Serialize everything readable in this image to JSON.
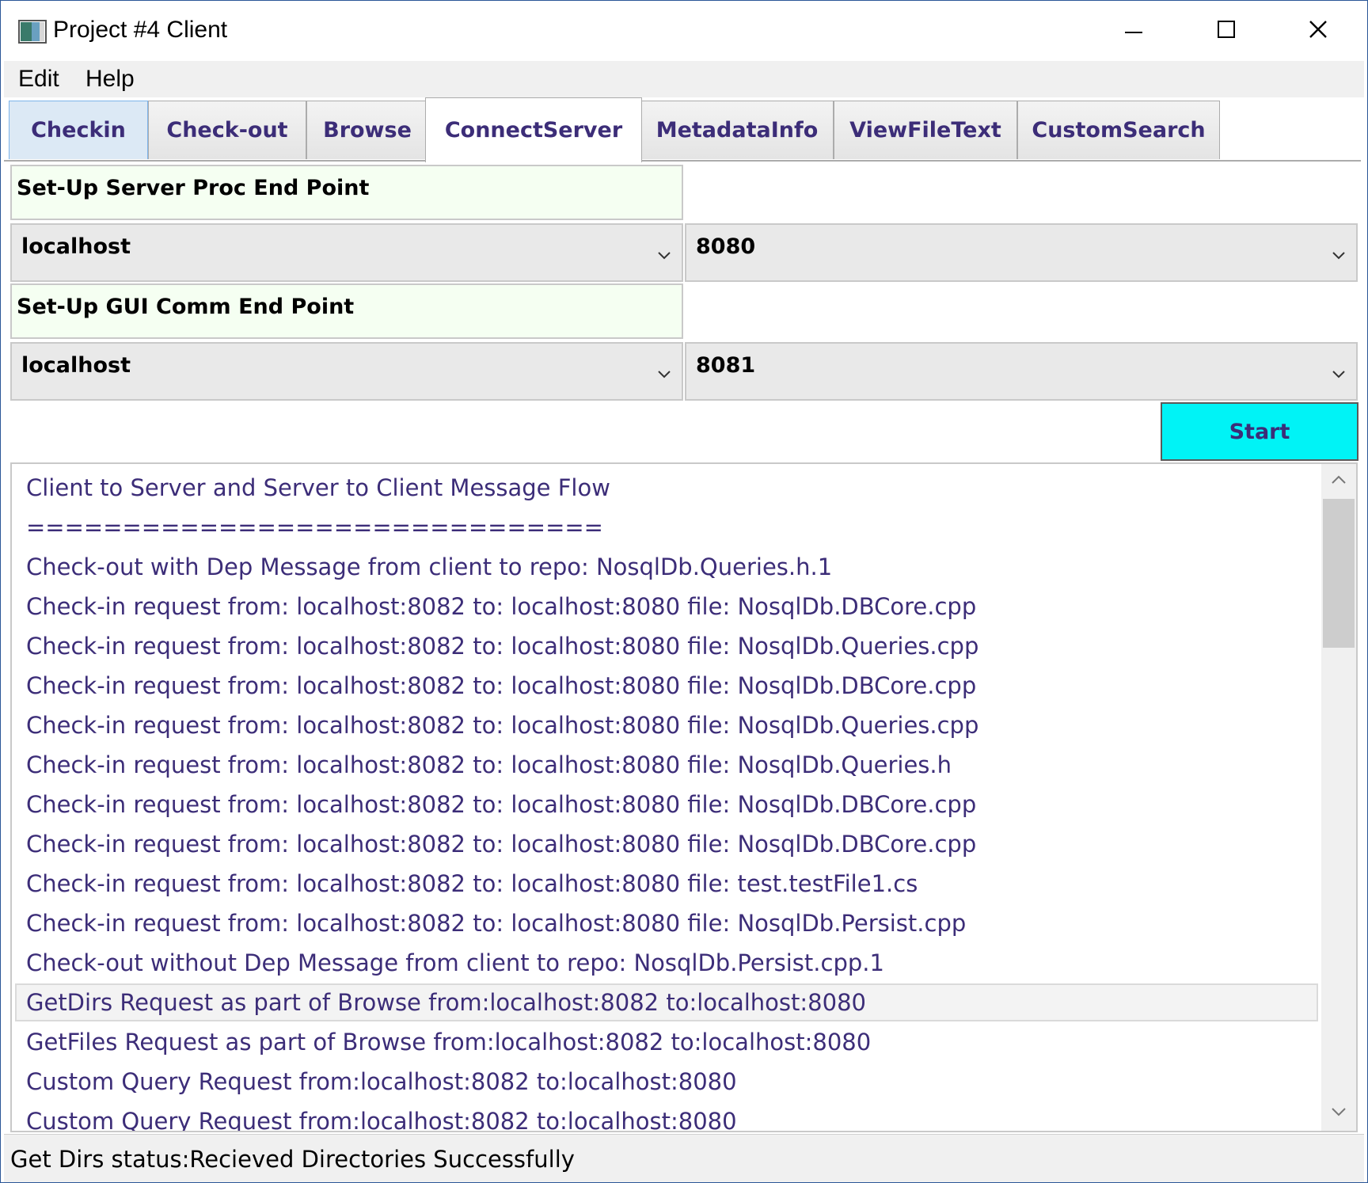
{
  "window": {
    "title": "Project #4 Client",
    "app_icon": "app-window-icon",
    "controls": {
      "minimize": "minimize-icon",
      "maximize": "maximize-icon",
      "close": "close-icon"
    }
  },
  "menu": {
    "items": [
      "Edit",
      "Help"
    ]
  },
  "tabs": [
    {
      "label": "Checkin"
    },
    {
      "label": "Check-out"
    },
    {
      "label": "Browse"
    },
    {
      "label": "ConnectServer"
    },
    {
      "label": "MetadataInfo"
    },
    {
      "label": "ViewFileText"
    },
    {
      "label": "CustomSearch"
    }
  ],
  "active_tab": "ConnectServer",
  "connect": {
    "server_label": "Set-Up Server Proc End Point",
    "server_host": "localhost",
    "server_port": "8080",
    "gui_label": "Set-Up GUI Comm End Point",
    "gui_host": "localhost",
    "gui_port": "8081",
    "start_label": "Start"
  },
  "messages": [
    "Client to Server and Server to Client Message Flow",
    "==============================",
    "Check-out with Dep Message from client to repo: NosqlDb.Queries.h.1",
    "Check-in request from: localhost:8082 to: localhost:8080 file: NosqlDb.DBCore.cpp",
    "Check-in request from: localhost:8082 to: localhost:8080 file: NosqlDb.Queries.cpp",
    "Check-in request from: localhost:8082 to: localhost:8080 file: NosqlDb.DBCore.cpp",
    "Check-in request from: localhost:8082 to: localhost:8080 file: NosqlDb.Queries.cpp",
    "Check-in request from: localhost:8082 to: localhost:8080 file: NosqlDb.Queries.h",
    "Check-in request from: localhost:8082 to: localhost:8080 file: NosqlDb.DBCore.cpp",
    "Check-in request from: localhost:8082 to: localhost:8080 file: NosqlDb.DBCore.cpp",
    "Check-in request from: localhost:8082 to: localhost:8080 file: test.testFile1.cs",
    "Check-in request from: localhost:8082 to: localhost:8080 file: NosqlDb.Persist.cpp",
    "Check-out without Dep Message from client to repo: NosqlDb.Persist.cpp.1",
    "GetDirs Request as part of Browse from:localhost:8082 to:localhost:8080",
    "GetFiles Request as part of Browse from:localhost:8082 to:localhost:8080",
    "Custom Query Request from:localhost:8082 to:localhost:8080",
    "Custom Query Request from:localhost:8082 to:localhost:8080"
  ],
  "selected_message_index": 13,
  "status": {
    "text": "Get Dirs status:Recieved Directories Successfully"
  },
  "colors": {
    "accent_text": "#3c2d78",
    "start_button": "#00f3f6",
    "label_bg": "#f5fff2"
  }
}
